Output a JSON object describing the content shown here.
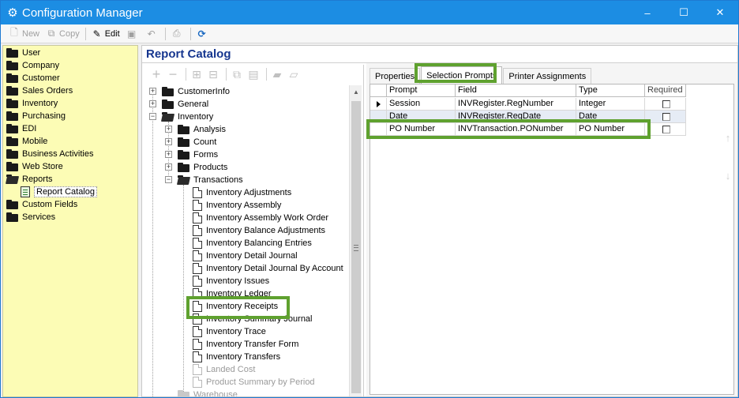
{
  "window": {
    "title": "Configuration Manager",
    "controls": [
      "–",
      "☐",
      "✕"
    ]
  },
  "toolbar": {
    "new_label": "New",
    "copy_label": "Copy",
    "edit_label": "Edit"
  },
  "nav": {
    "items": [
      {
        "label": "User"
      },
      {
        "label": "Company"
      },
      {
        "label": "Customer"
      },
      {
        "label": "Sales Orders"
      },
      {
        "label": "Inventory"
      },
      {
        "label": "Purchasing"
      },
      {
        "label": "EDI"
      },
      {
        "label": "Mobile"
      },
      {
        "label": "Business Activities"
      },
      {
        "label": "Web Store"
      },
      {
        "label": "Reports"
      },
      {
        "label": "Report Catalog"
      },
      {
        "label": "Custom Fields"
      },
      {
        "label": "Services"
      }
    ]
  },
  "main": {
    "title": "Report Catalog"
  },
  "tree": {
    "top": [
      {
        "label": "CustomerInfo"
      },
      {
        "label": "General"
      },
      {
        "label": "Inventory"
      }
    ],
    "inventory_children": [
      {
        "label": "Analysis"
      },
      {
        "label": "Count"
      },
      {
        "label": "Forms"
      },
      {
        "label": "Products"
      },
      {
        "label": "Transactions"
      }
    ],
    "transactions": [
      {
        "label": "Inventory Adjustments"
      },
      {
        "label": "Inventory Assembly"
      },
      {
        "label": "Inventory Assembly Work Order"
      },
      {
        "label": "Inventory Balance Adjustments"
      },
      {
        "label": "Inventory Balancing Entries"
      },
      {
        "label": "Inventory Detail Journal"
      },
      {
        "label": "Inventory Detail Journal By Account"
      },
      {
        "label": "Inventory Issues"
      },
      {
        "label": "Inventory Ledger"
      },
      {
        "label": "Inventory Receipts"
      },
      {
        "label": "Inventory Summary Journal"
      },
      {
        "label": "Inventory Trace"
      },
      {
        "label": "Inventory Transfer Form"
      },
      {
        "label": "Inventory Transfers"
      },
      {
        "label": "Landed Cost"
      },
      {
        "label": "Product Summary by Period"
      }
    ],
    "after": {
      "label": "Warehouse"
    }
  },
  "tabs": [
    {
      "label": "Properties"
    },
    {
      "label": "Selection Prompts"
    },
    {
      "label": "Printer Assignments"
    }
  ],
  "grid": {
    "columns": [
      "Prompt",
      "Field",
      "Type",
      "Required"
    ],
    "rows": [
      {
        "prompt": "Session",
        "field": "INVRegister.RegNumber",
        "type": "Integer"
      },
      {
        "prompt": "Date",
        "field": "INVRegister.RegDate",
        "type": "Date"
      },
      {
        "prompt": "PO Number",
        "field": "INVTransaction.PONumber",
        "type": "PO Number"
      }
    ]
  },
  "colors": {
    "titlebar": "#1c8de3",
    "nav_bg": "#fcfcb5",
    "heading": "#16368f",
    "highlight": "#5fa12f"
  }
}
